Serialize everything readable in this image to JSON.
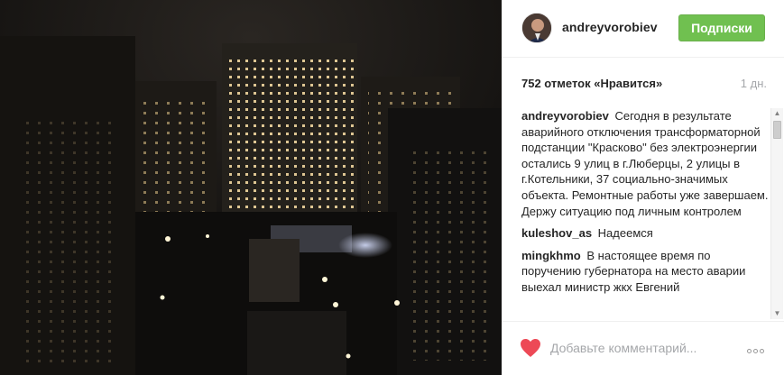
{
  "post": {
    "image_description_icon": "photo",
    "author": {
      "username": "andreyvorobiev",
      "avatar_icon": "avatar"
    },
    "follow_label": "Подписки",
    "likes": "752 отметок «Нравится»",
    "age": "1 дн.",
    "comments": [
      {
        "author": "andreyvorobiev",
        "text": "Сегодня в результате аварийного отключения трансформаторной подстанции \"Красково\" без электроэнергии остались 9 улиц в г.Люберцы, 2 улицы в г.Котельники, 37 социально-значимых объекта. Ремонтные работы уже завершаем. Держу ситуацию под личным контролем"
      },
      {
        "author": "kuleshov_as",
        "text": "Надеемся"
      },
      {
        "author": "mingkhmo",
        "text": "В настоящее время по поручению губернатора на место аварии выехал министр жкх Евгений"
      }
    ],
    "comment_placeholder": "Добавьте комментарий...",
    "like_icon": "heart-icon",
    "more_icon": "more-options-icon"
  },
  "colors": {
    "follow_button": "#70c050",
    "heart": "#ed4956",
    "muted_text": "#a5a7aa"
  }
}
